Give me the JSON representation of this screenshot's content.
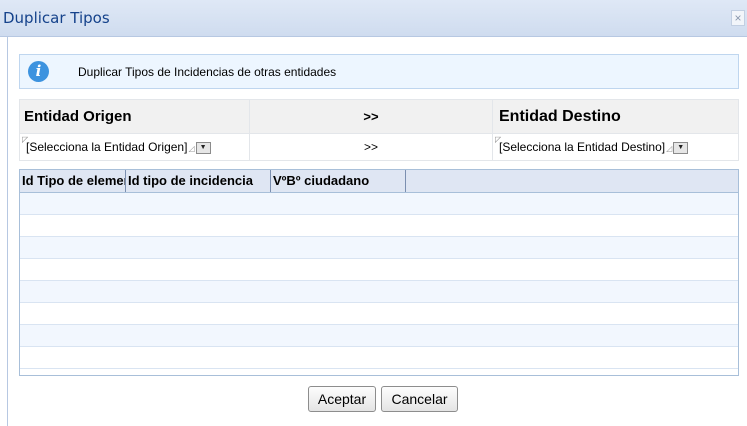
{
  "window": {
    "title": "Duplicar Tipos",
    "close_glyph": "×"
  },
  "info": {
    "icon": "info-icon",
    "text": "Duplicar Tipos de Incidencias de otras entidades"
  },
  "selector": {
    "origin_header": "Entidad Origen",
    "middle_header": ">>",
    "destination_header": "Entidad Destino",
    "origin_combo": "[Selecciona la Entidad Origen]",
    "middle_value": ">>",
    "destination_combo": "[Selecciona la Entidad Destino]"
  },
  "grid": {
    "columns": [
      "Id Tipo de elemento",
      "Id tipo de incidencia",
      "VºBº ciudadano"
    ],
    "rows": [
      [],
      [],
      [],
      [],
      [],
      [],
      [],
      []
    ]
  },
  "buttons": {
    "accept": "Aceptar",
    "cancel": "Cancelar"
  }
}
